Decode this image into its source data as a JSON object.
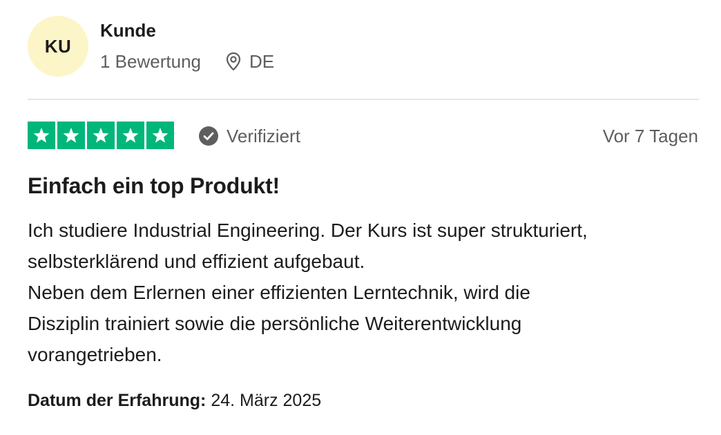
{
  "reviewer": {
    "initials": "KU",
    "name": "Kunde",
    "review_count": "1 Bewertung",
    "country": "DE"
  },
  "rating": {
    "stars": 5,
    "max_stars": 5,
    "star_color": "#00b67a"
  },
  "verified_label": "Verifiziert",
  "date_ago": "Vor 7 Tagen",
  "review": {
    "title": "Einfach ein top Produkt!",
    "body_lines": [
      "Ich studiere Industrial Engineering. Der Kurs ist super strukturiert,",
      "selbsterklärend und effizient aufgebaut.",
      "Neben dem Erlernen einer effizienten Lerntechnik, wird die",
      "Disziplin trainiert sowie die persönliche Weiterentwicklung",
      "vorangetrieben."
    ]
  },
  "experience": {
    "label": "Datum der Erfahrung:",
    "date": "24. März 2025"
  },
  "icons": {
    "location": "map-pin-icon",
    "verified": "check-circle-icon",
    "star": "star-icon"
  },
  "colors": {
    "avatar_bg": "#fcf5c7",
    "text_primary": "#1c1c1c",
    "text_secondary": "#5e5e5e",
    "divider": "#e5e5e5"
  }
}
